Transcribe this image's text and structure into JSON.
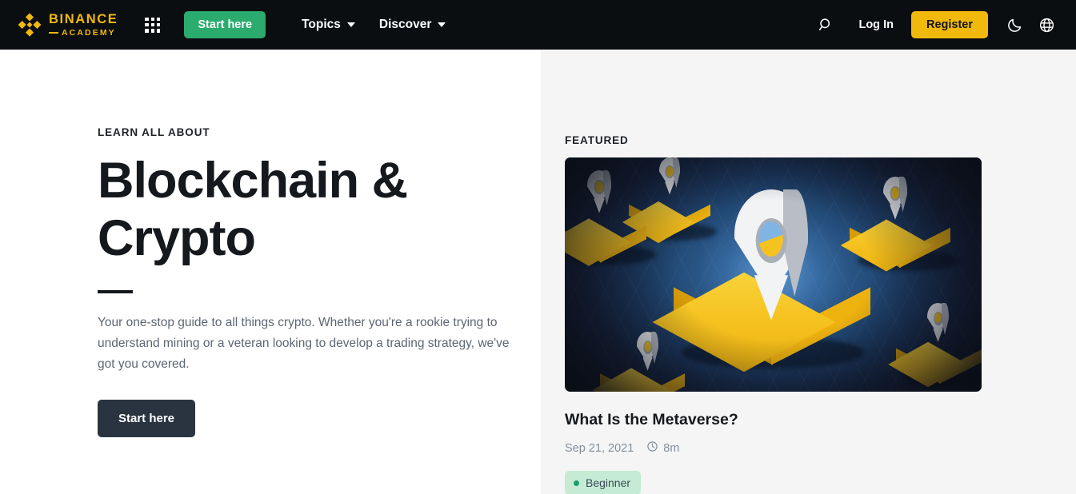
{
  "nav": {
    "logo": {
      "name": "BINANCE",
      "sub": "ACADEMY",
      "icon": "binance-diamond-icon"
    },
    "grid_icon": "apps-grid-icon",
    "start_here_label": "Start here",
    "menu": [
      {
        "label": "Topics",
        "icon": "chevron-down-icon"
      },
      {
        "label": "Discover",
        "icon": "chevron-down-icon"
      }
    ],
    "search_icon": "search-icon",
    "login_label": "Log In",
    "register_label": "Register",
    "theme_icon": "moon-icon",
    "language_icon": "globe-icon",
    "colors": {
      "bar": "#0b0e11",
      "brand_yellow": "#f0b90b",
      "green": "#2bab6e"
    }
  },
  "hero": {
    "eyebrow": "LEARN ALL ABOUT",
    "title": "Blockchain & Crypto",
    "description": "Your one-stop guide to all things crypto. Whether you're a rookie trying to understand mining or a veteran looking to develop a trading strategy, we've got you covered.",
    "cta_label": "Start here",
    "cta_color": "#293440"
  },
  "featured": {
    "label": "FEATURED",
    "card": {
      "image_alt": "isometric-map-pins-illustration",
      "title": "What Is the Metaverse?",
      "date": "Sep 21, 2021",
      "read_time": "8m",
      "read_time_icon": "clock-icon",
      "level": "Beginner",
      "level_color": "#c5ebd4",
      "level_dot_color": "#1aa06a"
    }
  }
}
